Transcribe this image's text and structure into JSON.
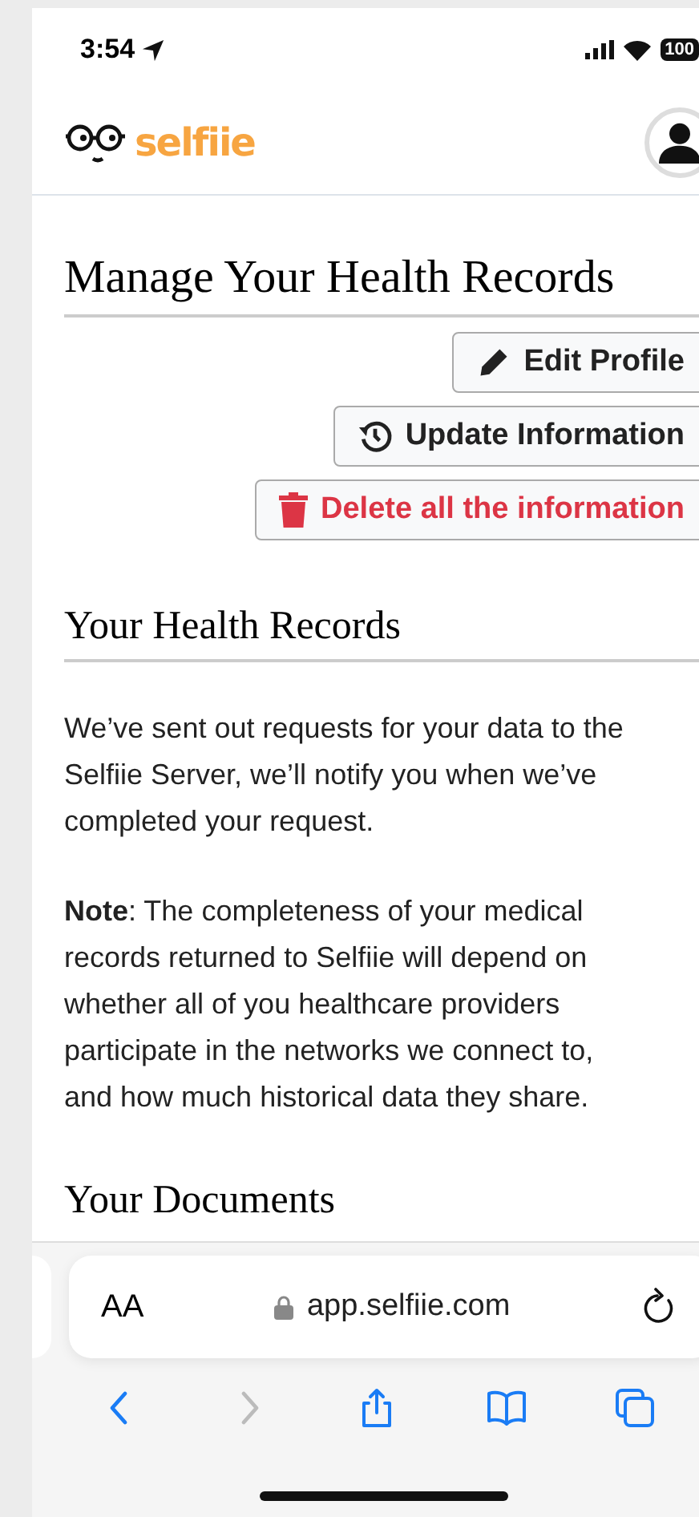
{
  "status_bar": {
    "time": "3:54",
    "battery": "100"
  },
  "header": {
    "logo_text": "selfiie"
  },
  "title": "Manage Your Health Records",
  "actions": [
    {
      "label": "Edit Profile",
      "kind": "edit"
    },
    {
      "label": "Update Information",
      "kind": "update"
    },
    {
      "label": "Delete all the information",
      "kind": "delete"
    }
  ],
  "section_title": "Your Health Records",
  "paragraphs": [
    "We’ve sent out requests for your data to the Selfiie Server, we’ll notify you when we’ve completed your request.",
    "**Note**: The completeness of your medical records returned to Selfiie will depend on whether all of you healthcare providers participate in the networks we connect to, and how much historical data they share."
  ],
  "documents_title": "Your Documents",
  "browser": {
    "text_size": "AA",
    "url": "app.selfiie.com",
    "nav": [
      {
        "kind": "back",
        "disabled": false
      },
      {
        "kind": "forward",
        "disabled": true
      },
      {
        "kind": "share",
        "disabled": false
      },
      {
        "kind": "bookmarks",
        "disabled": false
      },
      {
        "kind": "tabs",
        "disabled": false
      }
    ]
  }
}
